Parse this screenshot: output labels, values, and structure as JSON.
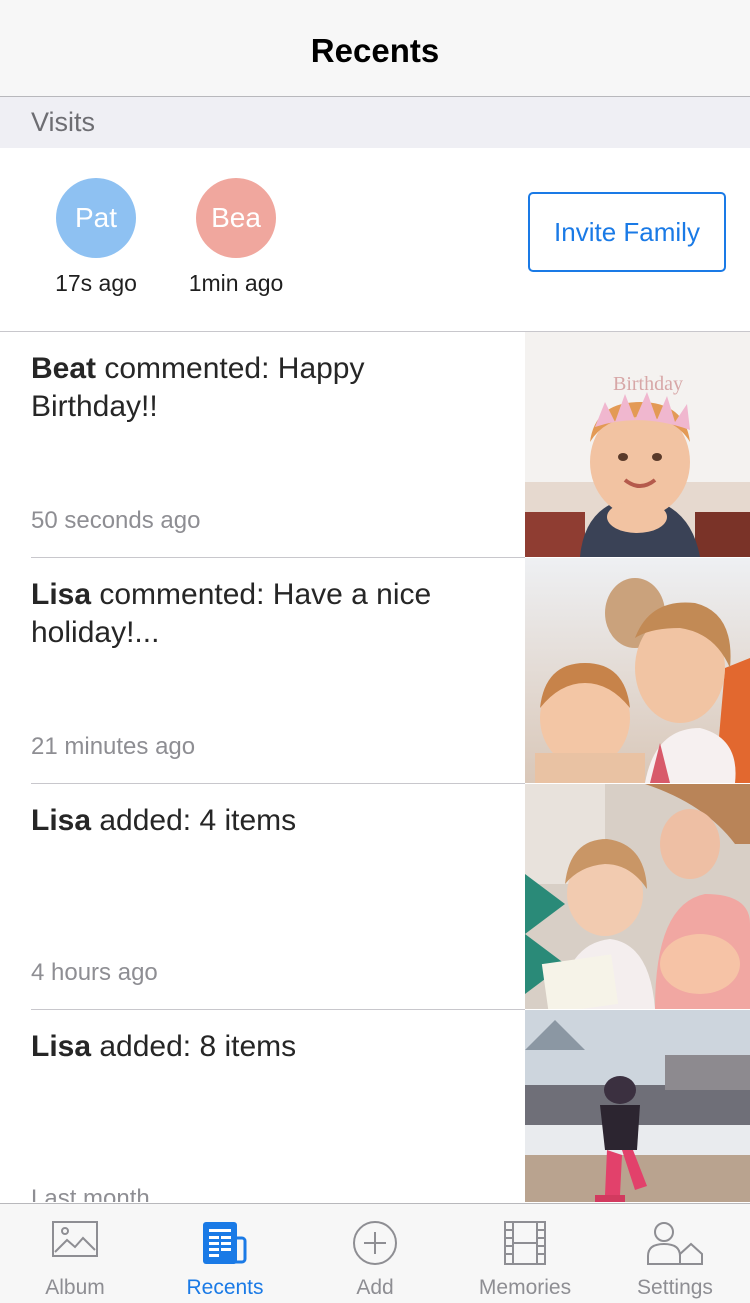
{
  "nav": {
    "title": "Recents"
  },
  "visits_section": {
    "header": "Visits"
  },
  "visitors": [
    {
      "initials": "Pat",
      "time": "17s ago",
      "color": "#8ec1f2"
    },
    {
      "initials": "Bea",
      "time": "1min ago",
      "color": "#f0a79e"
    }
  ],
  "invite_label": "Invite Family",
  "feed": [
    {
      "name": "Beat",
      "action": " commented: Happy Birthday!!",
      "time": "50 seconds ago"
    },
    {
      "name": "Lisa",
      "action": " commented: Have a nice holiday!...",
      "time": "21 minutes ago"
    },
    {
      "name": "Lisa",
      "action": " added: 4 items",
      "time": "4 hours ago"
    },
    {
      "name": "Lisa",
      "action": " added: 8 items",
      "time": "Last month"
    }
  ],
  "tabs": [
    {
      "label": "Album",
      "icon": "photo-icon"
    },
    {
      "label": "Recents",
      "icon": "recents-icon",
      "active": true
    },
    {
      "label": "Add",
      "icon": "plus-circle-icon"
    },
    {
      "label": "Memories",
      "icon": "film-icon"
    },
    {
      "label": "Settings",
      "icon": "people-icon"
    }
  ],
  "colors": {
    "accent": "#1a7ae6",
    "secondary_text": "#8e8e93"
  }
}
